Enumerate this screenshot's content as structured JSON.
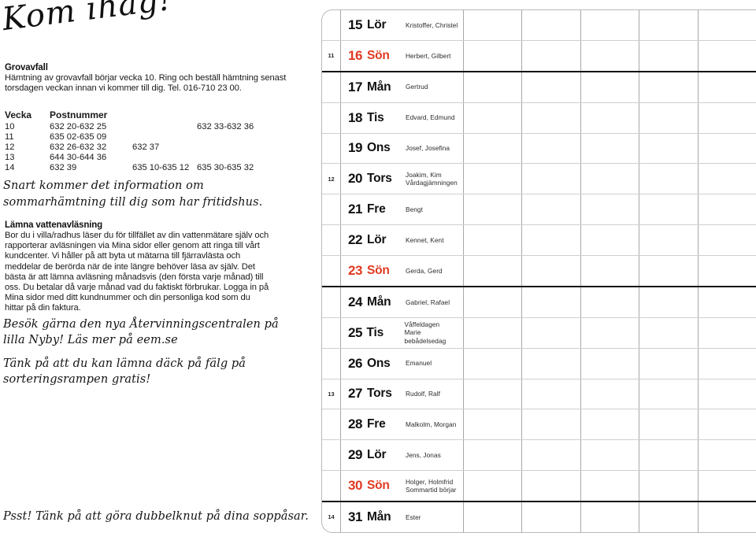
{
  "left": {
    "headline_script": "Kom ihåg!",
    "grovavfall": {
      "heading": "Grovavfall",
      "body": "Hämtning av grovavfall börjar vecka 10. Ring och beställ hämtning senast torsdagen veckan innan vi kommer till dig. Tel. 016-710 23 00."
    },
    "postnummer_table": {
      "col_week": "Vecka",
      "col_postnummer": "Postnummer",
      "rows": [
        {
          "week": "10",
          "a": "632 20-632 25",
          "b": "",
          "c": "632 33-632 36"
        },
        {
          "week": "11",
          "a": "635 02-635 09",
          "b": "",
          "c": ""
        },
        {
          "week": "12",
          "a": "632 26-632 32",
          "b": "632 37",
          "c": ""
        },
        {
          "week": "13",
          "a": "644 30-644 36",
          "b": "",
          "c": ""
        },
        {
          "week": "14",
          "a": "632 39",
          "b": "635 10-635 12",
          "c": "635 30-635 32"
        }
      ]
    },
    "handwritten_1": "Snart kommer det information om sommarhämtning till dig som har fritidshus.",
    "vattenavlasning": {
      "heading": "Lämna vattenavläsning",
      "body": "Bor du i villa/radhus läser du för tillfället av din vattenmätare själv och rapporterar avläsningen via Mina sidor eller genom att ringa till vårt kundcenter. Vi håller på att byta ut mätarna till fjärravlästa och meddelar de berörda när de inte längre behöver läsa av själv. Det bästa är att lämna avläsning månadsvis (den första varje månad) till oss. Du betalar då varje månad vad du faktiskt förbrukar. Logga in på Mina sidor med ditt kundnummer och din personliga kod som du hittar på din faktura."
    },
    "handwritten_2": "Besök gärna den nya Återvinningscentralen på lilla Nyby! Läs mer på eem.se",
    "handwritten_3": "Tänk på att du kan lämna däck på fälg på sorteringsrampen gratis!",
    "handwritten_4": "Psst! Tänk på att göra dubbelknut på dina soppåsar."
  },
  "calendar": {
    "sunday_color": "#e03a21",
    "rows": [
      {
        "week": "",
        "day": "15",
        "name": "Lör",
        "names": [
          "Kristoffer, Christel"
        ],
        "sunday": false,
        "thick": false
      },
      {
        "week": "11",
        "day": "16",
        "name": "Sön",
        "names": [
          "Herbert, Gilbert"
        ],
        "sunday": true,
        "thick": true
      },
      {
        "week": "",
        "day": "17",
        "name": "Mån",
        "names": [
          "Gertrud"
        ],
        "sunday": false,
        "thick": false
      },
      {
        "week": "",
        "day": "18",
        "name": "Tis",
        "names": [
          "Edvard, Edmund"
        ],
        "sunday": false,
        "thick": false
      },
      {
        "week": "",
        "day": "19",
        "name": "Ons",
        "names": [
          "Josef, Josefina"
        ],
        "sunday": false,
        "thick": false
      },
      {
        "week": "12",
        "day": "20",
        "name": "Tors",
        "names": [
          "Joakim, Kim",
          "Vårdagjämningen"
        ],
        "sunday": false,
        "thick": false
      },
      {
        "week": "",
        "day": "21",
        "name": "Fre",
        "names": [
          "Bengt"
        ],
        "sunday": false,
        "thick": false
      },
      {
        "week": "",
        "day": "22",
        "name": "Lör",
        "names": [
          "Kennet, Kent"
        ],
        "sunday": false,
        "thick": false
      },
      {
        "week": "",
        "day": "23",
        "name": "Sön",
        "names": [
          "Gerda, Gerd"
        ],
        "sunday": true,
        "thick": true
      },
      {
        "week": "",
        "day": "24",
        "name": "Mån",
        "names": [
          "Gabriel, Rafael"
        ],
        "sunday": false,
        "thick": false
      },
      {
        "week": "",
        "day": "25",
        "name": "Tis",
        "names": [
          "Våffeldagen",
          "Marie bebådelsedag"
        ],
        "sunday": false,
        "thick": false
      },
      {
        "week": "",
        "day": "26",
        "name": "Ons",
        "names": [
          "Emanuel"
        ],
        "sunday": false,
        "thick": false
      },
      {
        "week": "13",
        "day": "27",
        "name": "Tors",
        "names": [
          "Rudolf, Ralf"
        ],
        "sunday": false,
        "thick": false
      },
      {
        "week": "",
        "day": "28",
        "name": "Fre",
        "names": [
          "Malkolm, Morgan"
        ],
        "sunday": false,
        "thick": false
      },
      {
        "week": "",
        "day": "29",
        "name": "Lör",
        "names": [
          "Jens, Jonas"
        ],
        "sunday": false,
        "thick": false
      },
      {
        "week": "",
        "day": "30",
        "name": "Sön",
        "names": [
          "Holger, Holmfrid",
          "Sommartid börjar"
        ],
        "sunday": true,
        "thick": true
      },
      {
        "week": "14",
        "day": "31",
        "name": "Mån",
        "names": [
          "Ester"
        ],
        "sunday": false,
        "thick": false
      }
    ],
    "note_columns": 5
  }
}
